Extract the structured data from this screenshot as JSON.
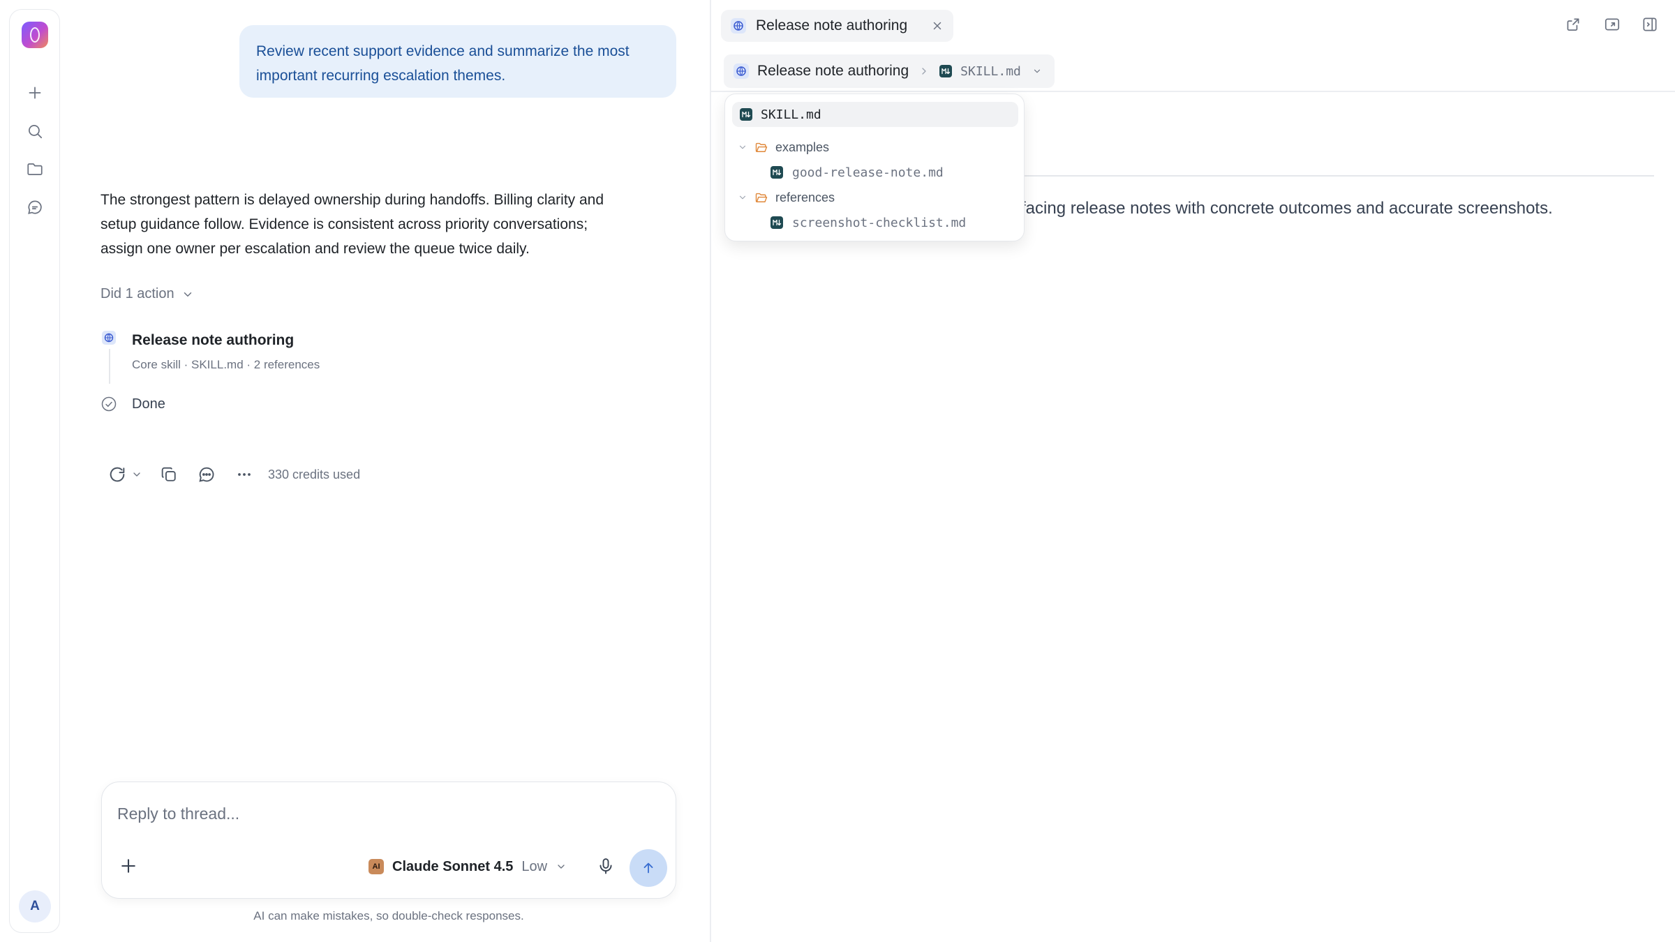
{
  "rail": {
    "avatar_initial": "A",
    "icons": [
      "new-chat-icon",
      "search-icon",
      "folder-icon",
      "chat-bubble-icon"
    ]
  },
  "chat": {
    "user_message": "Review recent support evidence and summarize the most important recurring escalation themes.",
    "answer": "The strongest pattern is delayed ownership during handoffs. Billing clarity and setup guidance follow. Evidence is consistent across priority conversations; assign one owner per escalation and review the queue twice daily.",
    "actions_summary": "Did 1 action",
    "step": {
      "title": "Release note authoring",
      "subtitle": "Core skill · SKILL.md · 2 references"
    },
    "done_label": "Done",
    "credits": "330 credits used",
    "composer": {
      "placeholder": "Reply to thread...",
      "model_badge": "AI",
      "model_name": "Claude Sonnet 4.5",
      "effort": "Low"
    },
    "disclaimer": "AI can make mistakes, so double-check responses."
  },
  "panel": {
    "tab_title": "Release note authoring",
    "breadcrumb": {
      "skill": "Release note authoring",
      "file": "SKILL.md"
    },
    "file_menu": {
      "selected": "SKILL.md",
      "folders": [
        {
          "name": "examples",
          "files": [
            "good-release-note.md"
          ]
        },
        {
          "name": "references",
          "files": [
            "screenshot-checklist.md"
          ]
        }
      ]
    },
    "doc_text_visible": "facing release notes with concrete outcomes and accurate screenshots."
  },
  "colors": {
    "accent_blue": "#3b6fd1",
    "user_bubble_bg": "#e7f0fb",
    "user_bubble_text": "#1a4f97",
    "folder_orange": "#e0883a",
    "file_icon_teal": "#1f4a52"
  }
}
